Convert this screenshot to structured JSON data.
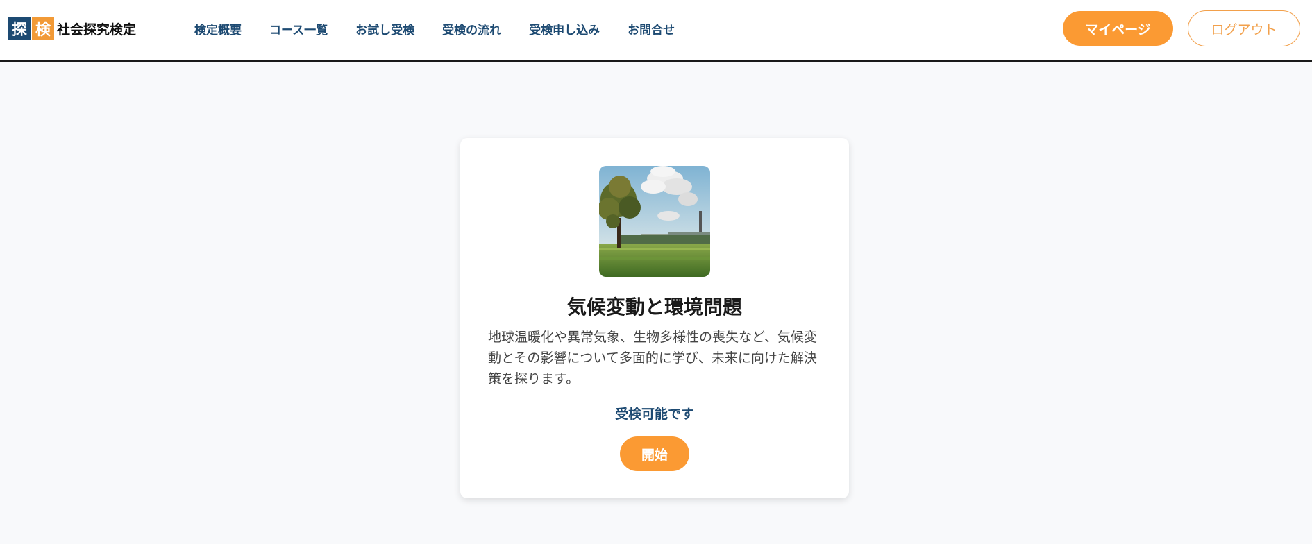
{
  "header": {
    "logo": {
      "char1": "探",
      "char2": "検",
      "text": "社会探究検定"
    },
    "nav": [
      {
        "label": "検定概要"
      },
      {
        "label": "コース一覧"
      },
      {
        "label": "お試し受検"
      },
      {
        "label": "受検の流れ"
      },
      {
        "label": "受検申し込み"
      },
      {
        "label": "お問合せ"
      }
    ],
    "mypage_label": "マイページ",
    "logout_label": "ログアウト"
  },
  "course": {
    "image_icon": "climate-factory-photo",
    "title": "気候変動と環境問題",
    "description": "地球温暖化や異常気象、生物多様性の喪失など、気候変動とその影響について多面的に学び、未来に向けた解決策を探ります。",
    "status": "受検可能です",
    "start_label": "開始"
  },
  "colors": {
    "brand_navy": "#1d4a72",
    "brand_orange": "#fb9a33",
    "background": "#f8f9fb"
  }
}
